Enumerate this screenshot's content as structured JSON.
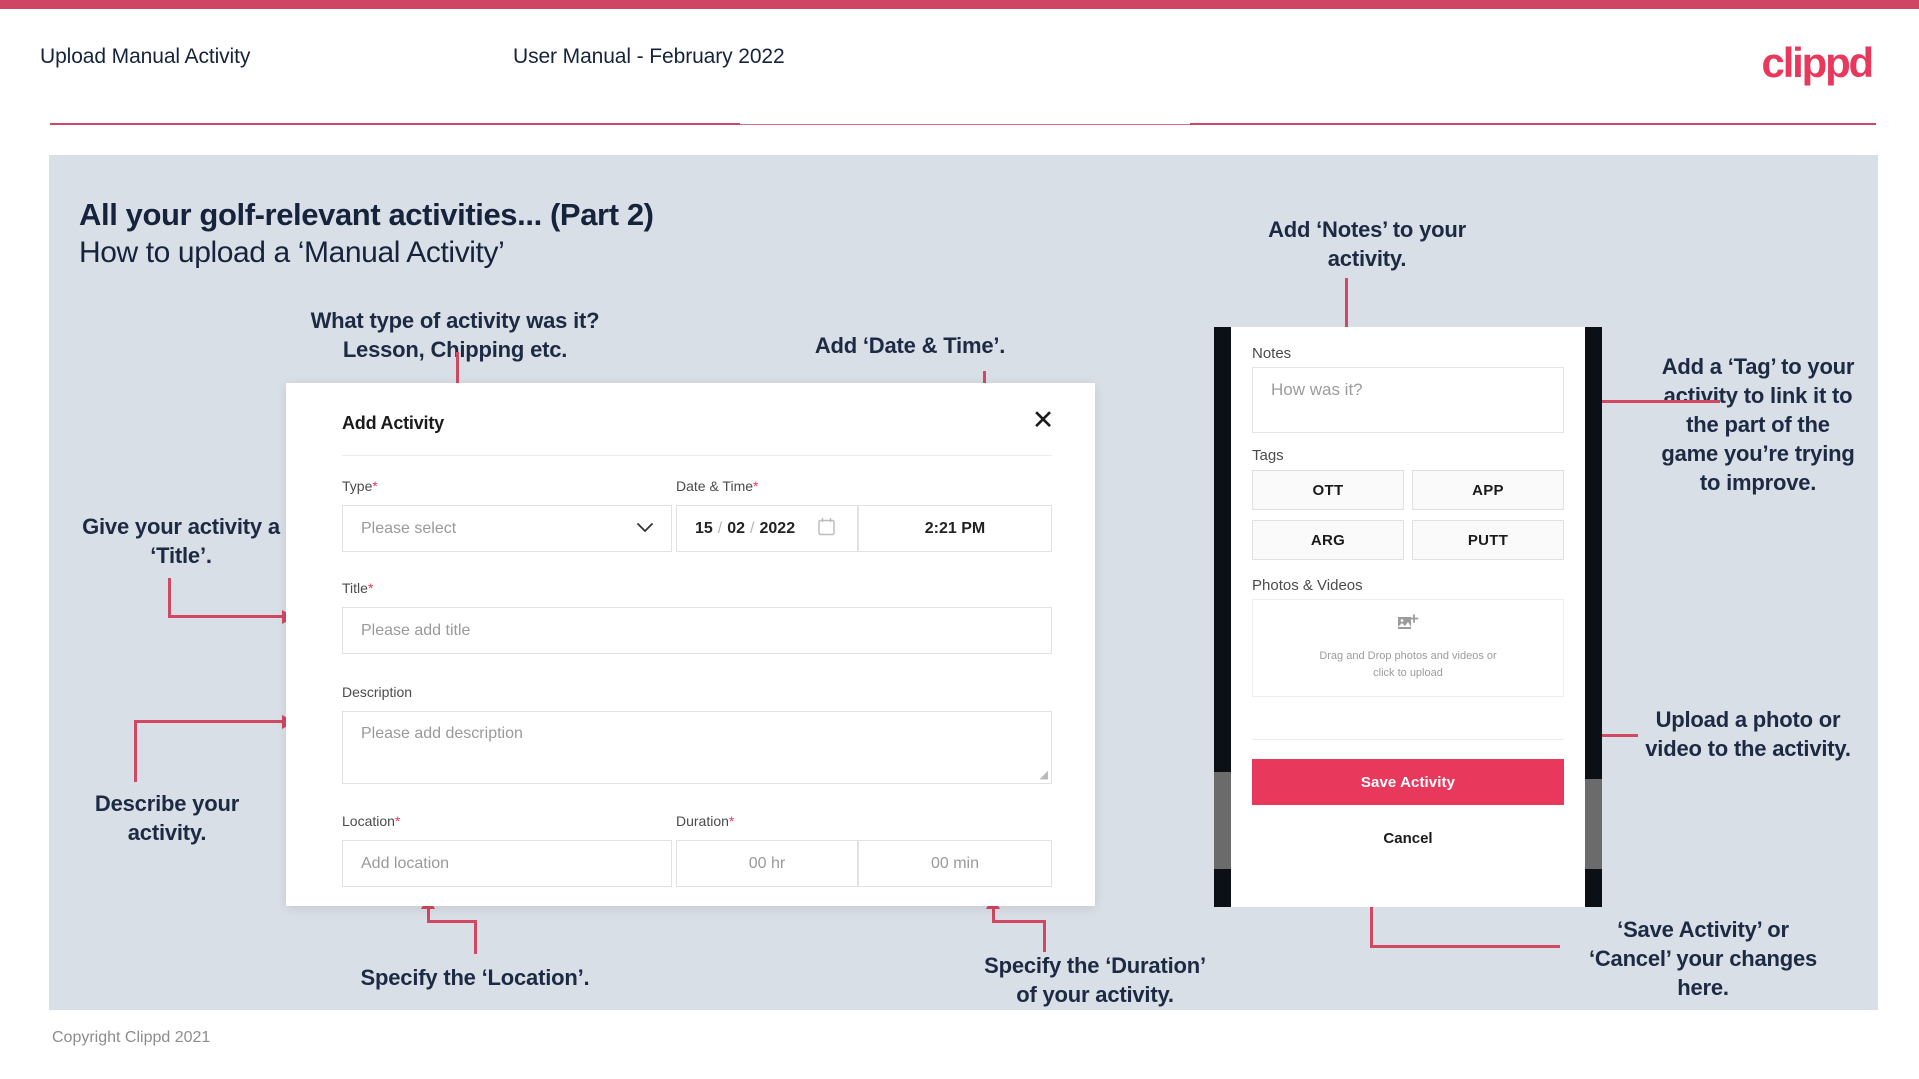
{
  "header": {
    "title": "Upload Manual Activity",
    "subtitle": "User Manual - February 2022",
    "logo": "clippd"
  },
  "slide": {
    "title": "All your golf-relevant activities... (Part 2)",
    "subtitle": "How to upload a ‘Manual Activity’"
  },
  "annotations": {
    "type": "What type of activity was it?\nLesson, Chipping etc.",
    "date_time": "Add ‘Date & Time’.",
    "title": "Give your activity a\n‘Title’.",
    "description": "Describe your\nactivity.",
    "location": "Specify the ‘Location’.",
    "duration": "Specify the ‘Duration’\nof your activity.",
    "notes": "Add ‘Notes’ to your\nactivity.",
    "tags": "Add a ‘Tag’ to your\nactivity to link it to\nthe part of the\ngame you’re trying\nto improve.",
    "photos": "Upload a photo or\nvideo to the activity.",
    "save_cancel": "‘Save Activity’ or\n‘Cancel’ your changes\nhere."
  },
  "dialog": {
    "title": "Add Activity",
    "close_icon": "✕",
    "fields": {
      "type": {
        "label": "Type",
        "required": "*",
        "placeholder": "Please select"
      },
      "date_time": {
        "label": "Date & Time",
        "required": "*",
        "day": "15",
        "sep1": "/",
        "month": "02",
        "sep2": "/",
        "year": "2022",
        "time": "2:21 PM"
      },
      "title": {
        "label": "Title",
        "required": "*",
        "placeholder": "Please add title"
      },
      "description": {
        "label": "Description",
        "required": "",
        "placeholder": "Please add description"
      },
      "location": {
        "label": "Location",
        "required": "*",
        "placeholder": "Add location"
      },
      "duration": {
        "label": "Duration",
        "required": "*",
        "hours_placeholder": "00 hr",
        "minutes_placeholder": "00 min"
      }
    }
  },
  "phone": {
    "notes": {
      "label": "Notes",
      "placeholder": "How was it?"
    },
    "tags": {
      "label": "Tags",
      "items": [
        "OTT",
        "APP",
        "ARG",
        "PUTT"
      ]
    },
    "photos": {
      "label": "Photos & Videos",
      "dropzone_line1": "Drag and Drop photos and videos or",
      "dropzone_line2": "click to upload"
    },
    "save_label": "Save Activity",
    "cancel_label": "Cancel"
  },
  "footer": {
    "copyright": "Copyright Clippd 2021"
  },
  "colors": {
    "accent": "#e8385c",
    "arrow": "#d24761",
    "slide_bg": "#d9dfe7",
    "text_dark": "#16233c"
  }
}
